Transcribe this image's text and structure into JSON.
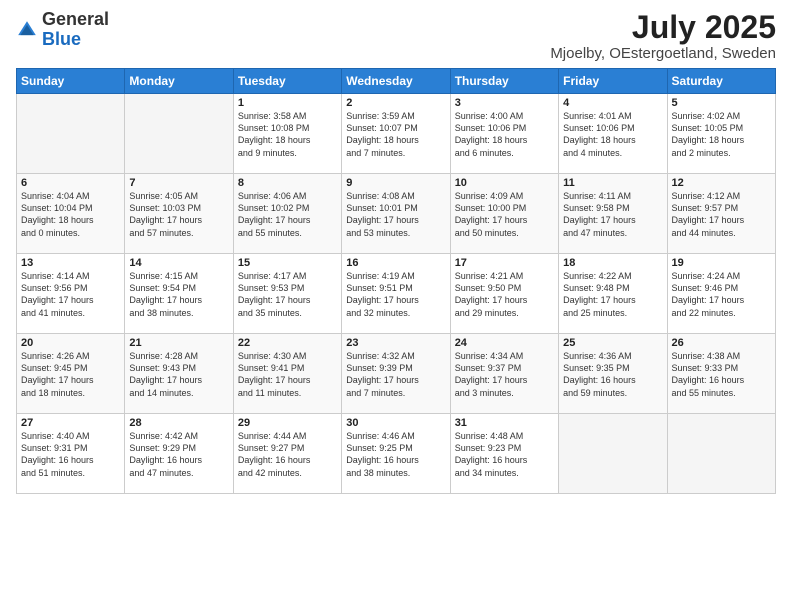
{
  "header": {
    "logo_general": "General",
    "logo_blue": "Blue",
    "month_year": "July 2025",
    "location": "Mjoelby, OEstergoetland, Sweden"
  },
  "days_of_week": [
    "Sunday",
    "Monday",
    "Tuesday",
    "Wednesday",
    "Thursday",
    "Friday",
    "Saturday"
  ],
  "weeks": [
    [
      {
        "day": "",
        "info": ""
      },
      {
        "day": "",
        "info": ""
      },
      {
        "day": "1",
        "info": "Sunrise: 3:58 AM\nSunset: 10:08 PM\nDaylight: 18 hours\nand 9 minutes."
      },
      {
        "day": "2",
        "info": "Sunrise: 3:59 AM\nSunset: 10:07 PM\nDaylight: 18 hours\nand 7 minutes."
      },
      {
        "day": "3",
        "info": "Sunrise: 4:00 AM\nSunset: 10:06 PM\nDaylight: 18 hours\nand 6 minutes."
      },
      {
        "day": "4",
        "info": "Sunrise: 4:01 AM\nSunset: 10:06 PM\nDaylight: 18 hours\nand 4 minutes."
      },
      {
        "day": "5",
        "info": "Sunrise: 4:02 AM\nSunset: 10:05 PM\nDaylight: 18 hours\nand 2 minutes."
      }
    ],
    [
      {
        "day": "6",
        "info": "Sunrise: 4:04 AM\nSunset: 10:04 PM\nDaylight: 18 hours\nand 0 minutes."
      },
      {
        "day": "7",
        "info": "Sunrise: 4:05 AM\nSunset: 10:03 PM\nDaylight: 17 hours\nand 57 minutes."
      },
      {
        "day": "8",
        "info": "Sunrise: 4:06 AM\nSunset: 10:02 PM\nDaylight: 17 hours\nand 55 minutes."
      },
      {
        "day": "9",
        "info": "Sunrise: 4:08 AM\nSunset: 10:01 PM\nDaylight: 17 hours\nand 53 minutes."
      },
      {
        "day": "10",
        "info": "Sunrise: 4:09 AM\nSunset: 10:00 PM\nDaylight: 17 hours\nand 50 minutes."
      },
      {
        "day": "11",
        "info": "Sunrise: 4:11 AM\nSunset: 9:58 PM\nDaylight: 17 hours\nand 47 minutes."
      },
      {
        "day": "12",
        "info": "Sunrise: 4:12 AM\nSunset: 9:57 PM\nDaylight: 17 hours\nand 44 minutes."
      }
    ],
    [
      {
        "day": "13",
        "info": "Sunrise: 4:14 AM\nSunset: 9:56 PM\nDaylight: 17 hours\nand 41 minutes."
      },
      {
        "day": "14",
        "info": "Sunrise: 4:15 AM\nSunset: 9:54 PM\nDaylight: 17 hours\nand 38 minutes."
      },
      {
        "day": "15",
        "info": "Sunrise: 4:17 AM\nSunset: 9:53 PM\nDaylight: 17 hours\nand 35 minutes."
      },
      {
        "day": "16",
        "info": "Sunrise: 4:19 AM\nSunset: 9:51 PM\nDaylight: 17 hours\nand 32 minutes."
      },
      {
        "day": "17",
        "info": "Sunrise: 4:21 AM\nSunset: 9:50 PM\nDaylight: 17 hours\nand 29 minutes."
      },
      {
        "day": "18",
        "info": "Sunrise: 4:22 AM\nSunset: 9:48 PM\nDaylight: 17 hours\nand 25 minutes."
      },
      {
        "day": "19",
        "info": "Sunrise: 4:24 AM\nSunset: 9:46 PM\nDaylight: 17 hours\nand 22 minutes."
      }
    ],
    [
      {
        "day": "20",
        "info": "Sunrise: 4:26 AM\nSunset: 9:45 PM\nDaylight: 17 hours\nand 18 minutes."
      },
      {
        "day": "21",
        "info": "Sunrise: 4:28 AM\nSunset: 9:43 PM\nDaylight: 17 hours\nand 14 minutes."
      },
      {
        "day": "22",
        "info": "Sunrise: 4:30 AM\nSunset: 9:41 PM\nDaylight: 17 hours\nand 11 minutes."
      },
      {
        "day": "23",
        "info": "Sunrise: 4:32 AM\nSunset: 9:39 PM\nDaylight: 17 hours\nand 7 minutes."
      },
      {
        "day": "24",
        "info": "Sunrise: 4:34 AM\nSunset: 9:37 PM\nDaylight: 17 hours\nand 3 minutes."
      },
      {
        "day": "25",
        "info": "Sunrise: 4:36 AM\nSunset: 9:35 PM\nDaylight: 16 hours\nand 59 minutes."
      },
      {
        "day": "26",
        "info": "Sunrise: 4:38 AM\nSunset: 9:33 PM\nDaylight: 16 hours\nand 55 minutes."
      }
    ],
    [
      {
        "day": "27",
        "info": "Sunrise: 4:40 AM\nSunset: 9:31 PM\nDaylight: 16 hours\nand 51 minutes."
      },
      {
        "day": "28",
        "info": "Sunrise: 4:42 AM\nSunset: 9:29 PM\nDaylight: 16 hours\nand 47 minutes."
      },
      {
        "day": "29",
        "info": "Sunrise: 4:44 AM\nSunset: 9:27 PM\nDaylight: 16 hours\nand 42 minutes."
      },
      {
        "day": "30",
        "info": "Sunrise: 4:46 AM\nSunset: 9:25 PM\nDaylight: 16 hours\nand 38 minutes."
      },
      {
        "day": "31",
        "info": "Sunrise: 4:48 AM\nSunset: 9:23 PM\nDaylight: 16 hours\nand 34 minutes."
      },
      {
        "day": "",
        "info": ""
      },
      {
        "day": "",
        "info": ""
      }
    ]
  ]
}
